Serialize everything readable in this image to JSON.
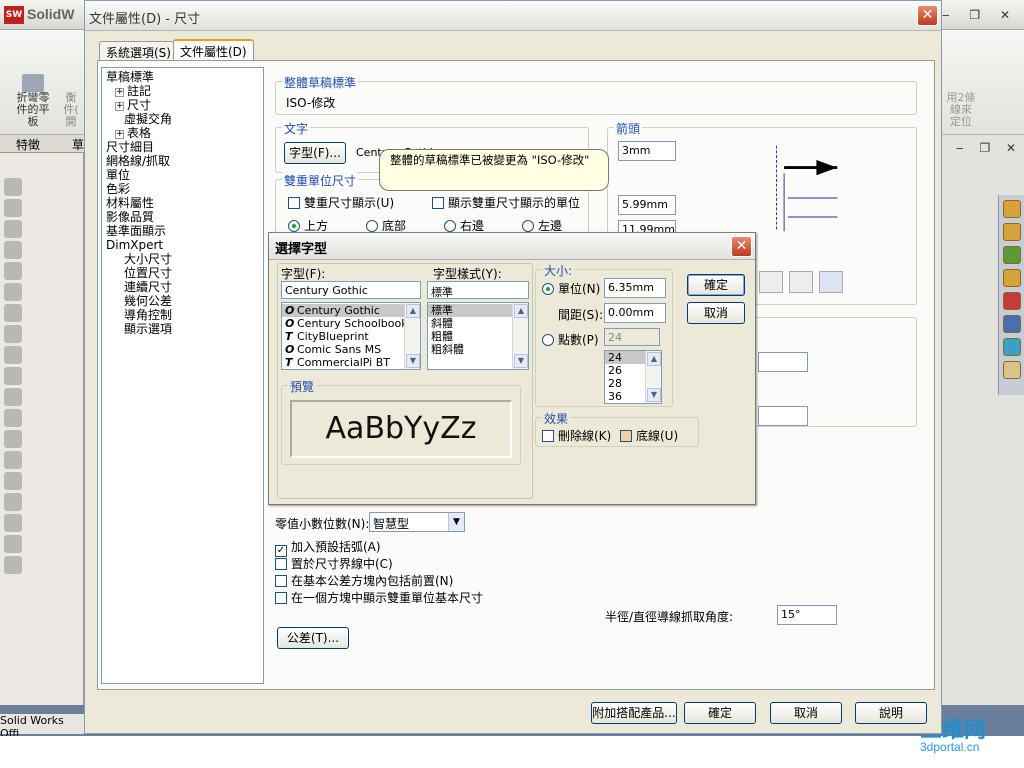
{
  "app": {
    "title": "SolidW",
    "logo": "SW",
    "toolbar_left": [
      "折彎零",
      "件的平",
      "板"
    ],
    "toolbar_left2": [
      "衡",
      "件(",
      "開"
    ],
    "toolbar_right": [
      "用2條",
      "線來",
      "定位"
    ],
    "tabs": [
      "特徵",
      "草"
    ],
    "status": "Solid Works Offi",
    "win_controls": "‒ ❐ ✕",
    "doc_controls": "‒ ❐ ✕"
  },
  "watermark": {
    "main": "三维网",
    "sub": "3dportal.cn"
  },
  "dialog": {
    "title": "文件屬性(D) - 尺寸",
    "tabs": [
      {
        "label": "系統選項(S)"
      },
      {
        "label": "文件屬性(D)"
      }
    ],
    "tree": [
      {
        "label": "草稿標準",
        "indent": 0,
        "expander": false
      },
      {
        "label": "註記",
        "indent": 1,
        "expander": true
      },
      {
        "label": "尺寸",
        "indent": 1,
        "expander": true
      },
      {
        "label": "虛擬交角",
        "indent": 2,
        "expander": false
      },
      {
        "label": "表格",
        "indent": 1,
        "expander": true
      },
      {
        "label": "尺寸細目",
        "indent": 0,
        "expander": false
      },
      {
        "label": "網格線/抓取",
        "indent": 0,
        "expander": false
      },
      {
        "label": "單位",
        "indent": 0,
        "expander": false
      },
      {
        "label": "色彩",
        "indent": 0,
        "expander": false
      },
      {
        "label": "材料屬性",
        "indent": 0,
        "expander": false
      },
      {
        "label": "影像品質",
        "indent": 0,
        "expander": false
      },
      {
        "label": "基準面顯示",
        "indent": 0,
        "expander": false
      },
      {
        "label": "DimXpert",
        "indent": 0,
        "expander": true
      },
      {
        "label": "大小尺寸",
        "indent": 2,
        "expander": false
      },
      {
        "label": "位置尺寸",
        "indent": 2,
        "expander": false
      },
      {
        "label": "連續尺寸",
        "indent": 2,
        "expander": false
      },
      {
        "label": "幾何公差",
        "indent": 2,
        "expander": false
      },
      {
        "label": "導角控制",
        "indent": 2,
        "expander": false
      },
      {
        "label": "顯示選項",
        "indent": 2,
        "expander": false
      }
    ],
    "overall_standard": {
      "label": "整體草稿標準",
      "value": "ISO-修改"
    },
    "text": {
      "label": "文字",
      "font_button": "字型(F)...",
      "font_value": "Century Gothic"
    },
    "tooltip": "整體的草稿標準已被變更為 \"ISO-修改\"",
    "dual": {
      "label": "雙重單位尺寸",
      "show_dual": "雙重尺寸顯示(U)",
      "show_units": "顯示雙重尺寸顯示的單位",
      "positions": [
        "上方",
        "底部",
        "右邊",
        "左邊"
      ],
      "selected_position": "上方"
    },
    "arrows": {
      "label": "箭頭",
      "values": [
        "3mm",
        "5.99mm",
        "11.99mm"
      ]
    },
    "zero_decimals": {
      "label": "零值小數位數(N):",
      "value": "智慧型"
    },
    "checkboxes": [
      {
        "label": "加入預設括弧(A)",
        "checked": true
      },
      {
        "label": "置於尺寸界線中(C)",
        "checked": false
      },
      {
        "label": "在基本公差方塊內包括前置(N)",
        "checked": false
      },
      {
        "label": "在一個方塊中顯示雙重單位基本尺寸",
        "checked": false
      }
    ],
    "radial_snap": {
      "label": "半徑/直徑導線抓取角度:",
      "value": "15°"
    },
    "tolerance_button": "公差(T)...",
    "buttons": {
      "add_config": "附加搭配產品...",
      "ok": "確定",
      "cancel": "取消",
      "help": "說明"
    }
  },
  "font_dialog": {
    "title": "選擇字型",
    "font_label": "字型(F):",
    "font_value": "Century Gothic",
    "fonts": [
      {
        "name": "Century Gothic",
        "icon": "O",
        "selected": true
      },
      {
        "name": "Century Schoolbook",
        "icon": "O",
        "selected": false
      },
      {
        "name": "CityBlueprint",
        "icon": "T",
        "selected": false
      },
      {
        "name": "Comic Sans MS",
        "icon": "O",
        "selected": false
      },
      {
        "name": "CommercialPi BT",
        "icon": "T",
        "selected": false
      }
    ],
    "style_label": "字型樣式(Y):",
    "style_value": "標準",
    "styles": [
      {
        "name": "標準",
        "selected": true
      },
      {
        "name": "斜體",
        "selected": false
      },
      {
        "name": "粗體",
        "selected": false
      },
      {
        "name": "粗斜體",
        "selected": false
      }
    ],
    "size_label": "大小:",
    "units_label": "單位(N)",
    "units_value": "6.35mm",
    "spacing_label": "間距(S):",
    "spacing_value": "0.00mm",
    "points_label": "點數(P)",
    "points_value": "24",
    "point_sizes": [
      {
        "v": "24",
        "selected": true
      },
      {
        "v": "26",
        "selected": false
      },
      {
        "v": "28",
        "selected": false
      },
      {
        "v": "36",
        "selected": false
      }
    ],
    "preview_label": "預覽",
    "preview_text": "AaBbYyZz",
    "effects_label": "效果",
    "strikeout": "刪除線(K)",
    "underline": "底線(U)",
    "ok": "確定",
    "cancel": "取消"
  }
}
